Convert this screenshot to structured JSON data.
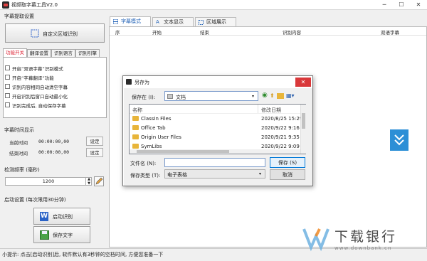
{
  "window": {
    "title": "视频取字幕工具V2.0",
    "minimize": "─",
    "maximize": "☐",
    "close": "✕"
  },
  "left": {
    "extract_group": "字幕提取设置",
    "custom_region_button": "自定义区域识别",
    "tabs": [
      "功能开关",
      "翻译设置",
      "识别语言",
      "识别引擎"
    ],
    "options": [
      "开启“双语字幕”识别模式",
      "开启“字幕翻译”功能",
      "识别内容相同自动清空字幕",
      "开启识别后窗口自动最小化",
      "识别完成后, 自动保存字幕"
    ],
    "time_group": "字幕时间显示",
    "current_time_label": "当前时间",
    "current_time_value": "00:00:00,00",
    "end_time_label": "结束时间",
    "end_time_value": "00:00:00,00",
    "set_button": "设定",
    "freq_group": "检测频率 (毫秒)",
    "freq_value": "1200",
    "start_group": "启动设置 (每次限用30分钟)",
    "start_button": "启动识别",
    "save_button": "保存文字"
  },
  "main": {
    "tabs": [
      "字幕模式",
      "文本显示",
      "区域展示"
    ],
    "columns": [
      "序",
      "开始",
      "结束",
      "识别内容",
      "双语字幕"
    ]
  },
  "dialog": {
    "title": "另存为",
    "save_in_label": "保存在 (I):",
    "save_in_value": "文档",
    "col_name": "名称",
    "col_date": "修改日期",
    "files": [
      {
        "name": "ClassIn Files",
        "date": "2020/8/25 15:29"
      },
      {
        "name": "Office Tab",
        "date": "2020/9/22 9:16"
      },
      {
        "name": "Origin User Files",
        "date": "2020/9/21 9:35"
      },
      {
        "name": "SymLibs",
        "date": "2020/9/22 9:09"
      }
    ],
    "filename_label": "文件名 (N):",
    "filename_value": "",
    "filetype_label": "保存类型 (T):",
    "filetype_value": "电子表格",
    "save_button": "保存 (S)",
    "cancel_button": "取消"
  },
  "status": {
    "text": "小提示: 点击[启动识别]后, 软件默认有3秒钟的空档时间, 方便您准备一下"
  },
  "watermark": {
    "text": "下载银行",
    "url": "www.downbank.cn"
  },
  "colors": {
    "accent": "#1d5fb5",
    "active_tab_text": "#d22233",
    "folder": "#e8b53a"
  }
}
